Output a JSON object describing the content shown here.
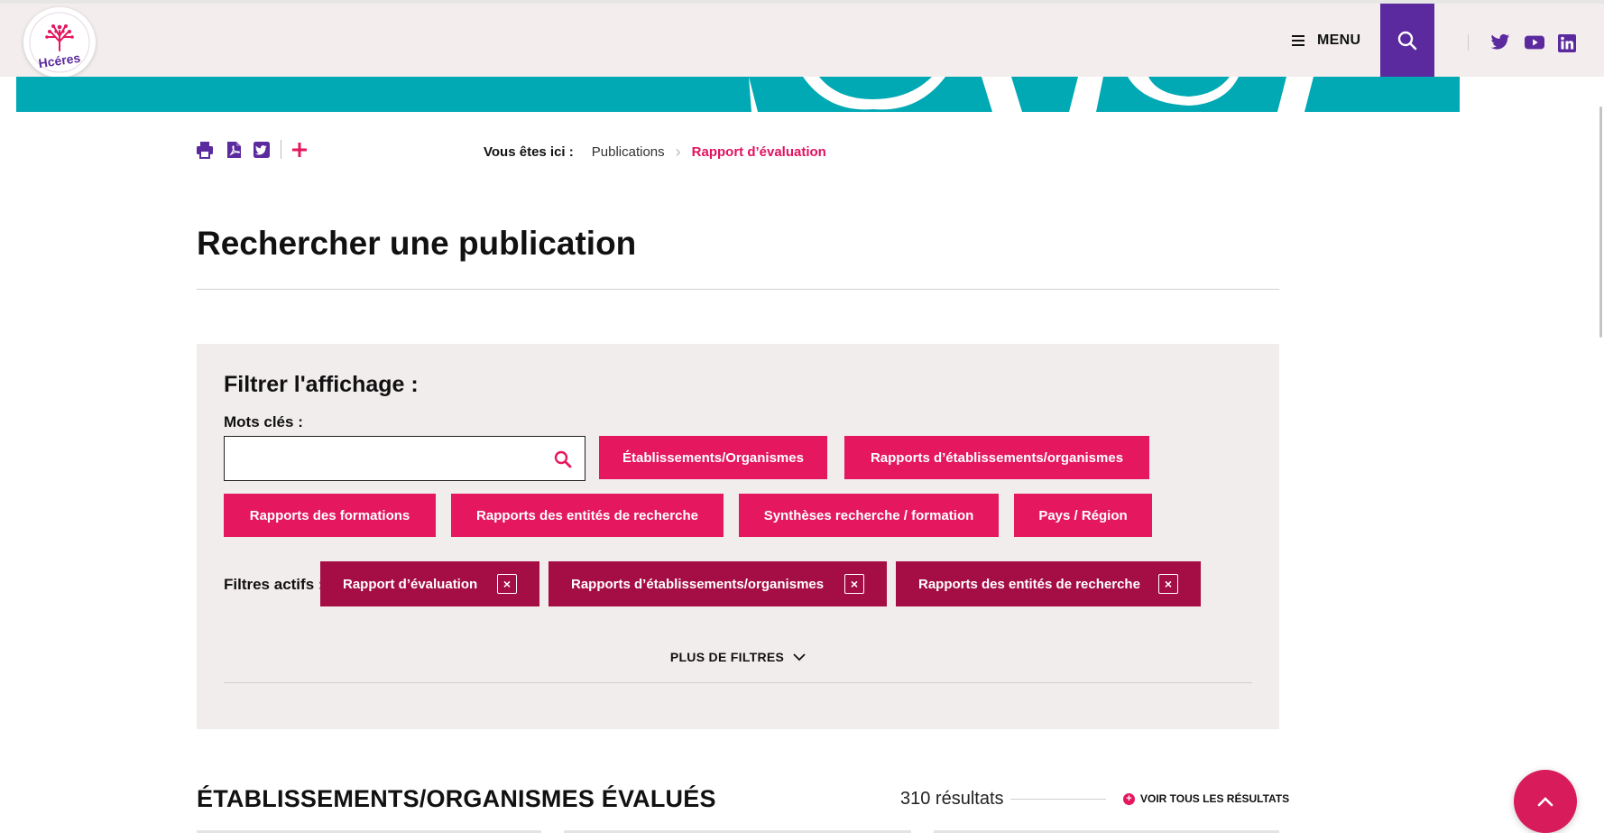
{
  "header": {
    "logo_text": "Hcéres",
    "menu_label": "MENU",
    "icons": {
      "search": "search-icon",
      "twitter": "twitter-icon",
      "youtube": "youtube-icon",
      "linkedin": "linkedin-icon"
    }
  },
  "colors": {
    "brand_pink": "#e4175f",
    "active_filter": "#a50e44",
    "header_purple": "#5b2a9e",
    "banner_teal": "#01a9b4",
    "icon_purple": "#5b2a9e"
  },
  "toolbar": {
    "icons": [
      "print-icon",
      "pdf-icon",
      "twitter-share-icon",
      "plus-icon"
    ]
  },
  "breadcrumb": {
    "prefix": "Vous êtes ici :",
    "items": [
      "Publications",
      "Rapport d’évaluation"
    ]
  },
  "page_title": "Rechercher une publication",
  "filters": {
    "title": "Filtrer l'affichage :",
    "keywords_label": "Mots clés :",
    "keywords_value": "",
    "category_buttons": [
      "Établissements/Organismes",
      "Rapports d’établissements/organismes",
      "Rapports des formations",
      "Rapports des entités de recherche",
      "Synthèses recherche / formation",
      "Pays / Région"
    ],
    "active_label": "Filtres actifs :",
    "active": [
      "Rapport d’évaluation",
      "Rapports d’établissements/organismes",
      "Rapports des entités de recherche"
    ],
    "remove_symbol": "×",
    "more_label": "PLUS DE FILTRES"
  },
  "results": {
    "title": "ÉTABLISSEMENTS/ORGANISMES ÉVALUÉS",
    "count": "310 résultats",
    "see_all": "VOIR TOUS LES RÉSULTATS",
    "plus_symbol": "+"
  },
  "back_to_top_icon": "arrow-up-icon"
}
